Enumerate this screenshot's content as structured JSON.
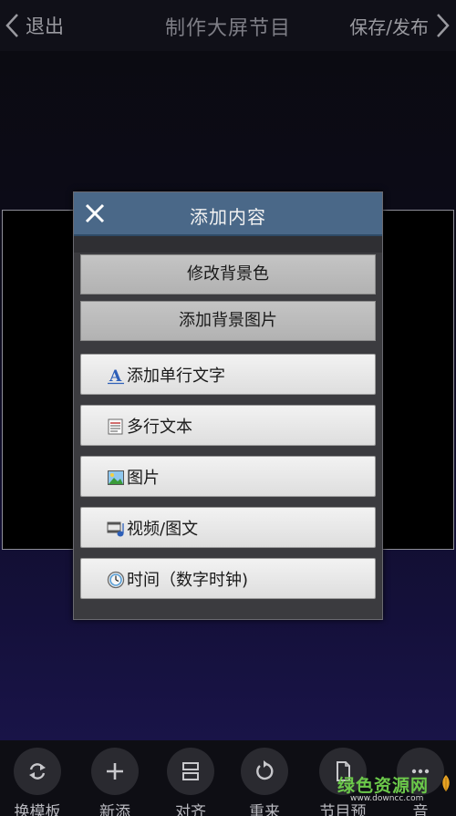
{
  "header": {
    "back_label": "退出",
    "title": "制作大屏节目",
    "save_label": "保存/发布"
  },
  "dialog": {
    "title": "添加内容",
    "background_buttons": [
      "修改背景色",
      "添加背景图片"
    ],
    "options": [
      {
        "label": "添加单行文字",
        "icon": "text-a-icon"
      },
      {
        "label": "多行文本",
        "icon": "multiline-text-icon"
      },
      {
        "label": "图片",
        "icon": "picture-icon"
      },
      {
        "label": "视频/图文",
        "icon": "video-icon"
      },
      {
        "label": "时间（数字时钟)",
        "icon": "clock-icon"
      }
    ]
  },
  "toolbar": {
    "items": [
      {
        "label": "换模板",
        "icon": "swap-icon"
      },
      {
        "label": "新添",
        "icon": "plus-icon"
      },
      {
        "label": "对齐",
        "icon": "align-icon"
      },
      {
        "label": "重来",
        "icon": "reset-icon"
      },
      {
        "label": "节目预",
        "icon": "document-icon"
      },
      {
        "label": "音",
        "icon": "more-icon"
      }
    ]
  },
  "watermark": {
    "text": "绿色资源网",
    "sub": "www.downcc.com"
  },
  "colors": {
    "dialog_header": "#4a6888",
    "watermark_green": "#6bc84a",
    "background_bottom": "#1c1650"
  }
}
